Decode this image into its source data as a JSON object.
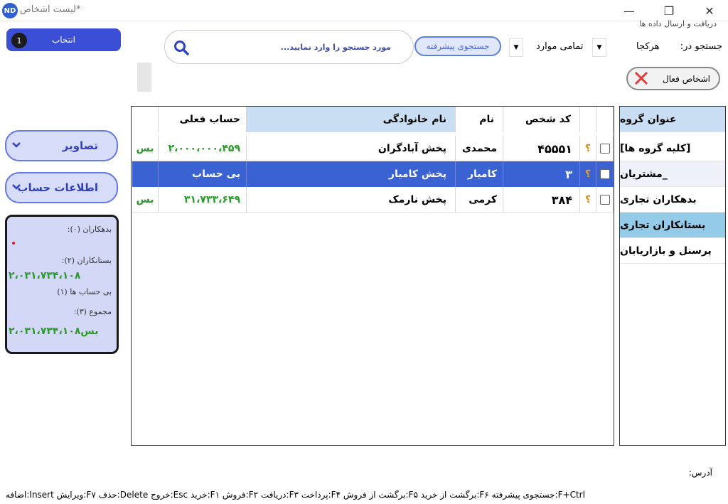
{
  "window": {
    "title": "لیست اشخاص*",
    "logo_text": "ND"
  },
  "top": {
    "sync_label": "دریافت و ارسال داده ها",
    "search_where_label": "جستجو در:",
    "search_where_value": "هرکجا",
    "scope_value": "تمامی موارد",
    "advanced_search": "جستجوی پیشرفته",
    "search_placeholder": "مورد جستجو را وارد نمایید..."
  },
  "active_people_label": "اشخاص فعال",
  "select": {
    "label": "انتخاب",
    "count": "1"
  },
  "side_buttons": {
    "images": "تصاویر",
    "account_info": "اطلاعات حساب"
  },
  "summary": {
    "debtors_label": "بدهکاران (۰):",
    "debtors_value": "",
    "creditors_label": "بستانکاران (۲):",
    "creditors_value": "۲،۰۳۱،۷۳۴،۱۰۸",
    "no_account_label": "بی حساب ها (۱)",
    "total_label": "مجموع (۳):",
    "total_value": "۲،۰۳۱،۷۳۴،۱۰۸بس"
  },
  "table": {
    "headers": {
      "code": "کد شخص",
      "name": "نام",
      "family": "نام خانوادگی",
      "balance": "حساب فعلی"
    },
    "rows": [
      {
        "code": "۴۵۵۵۱",
        "name": "محمدی",
        "family": "پخش آبادگران",
        "balance": "۲،۰۰۰،۰۰۰،۴۵۹",
        "status": "بس",
        "mark": "؟"
      },
      {
        "code": "۳",
        "name": "کامیار",
        "family": "پخش کامیار",
        "balance": "بی حساب",
        "status": "",
        "mark": "؟"
      },
      {
        "code": "۳۸۴",
        "name": "کرمی",
        "family": "پخش نارمک",
        "balance": "۳۱،۷۳۳،۶۴۹",
        "status": "بس",
        "mark": "؟"
      }
    ]
  },
  "groups": {
    "header": "عنوان گروه",
    "items": [
      "[کلیه گروه ها]",
      "_مشتریان",
      "بدهکاران تجاری",
      "بستانکاران تجاری",
      "پرسنل و بازاریابان"
    ]
  },
  "address_label": "آدرس:",
  "shortcuts": "اضافه:Insert   ویرایش:F۷   حذف:Delete   خروج:Esc   خرید:F۱   فروش:F۲   دریافت:F۳   پرداخت:F۴   برگشت از فروش:F۵   برگشت از خرید:F۶   جستجوی پیشرفته:F+Ctrl",
  "colors": {
    "accent": "#3b62d3",
    "green": "#2a9a2a",
    "group_selected": "#c9def2"
  }
}
